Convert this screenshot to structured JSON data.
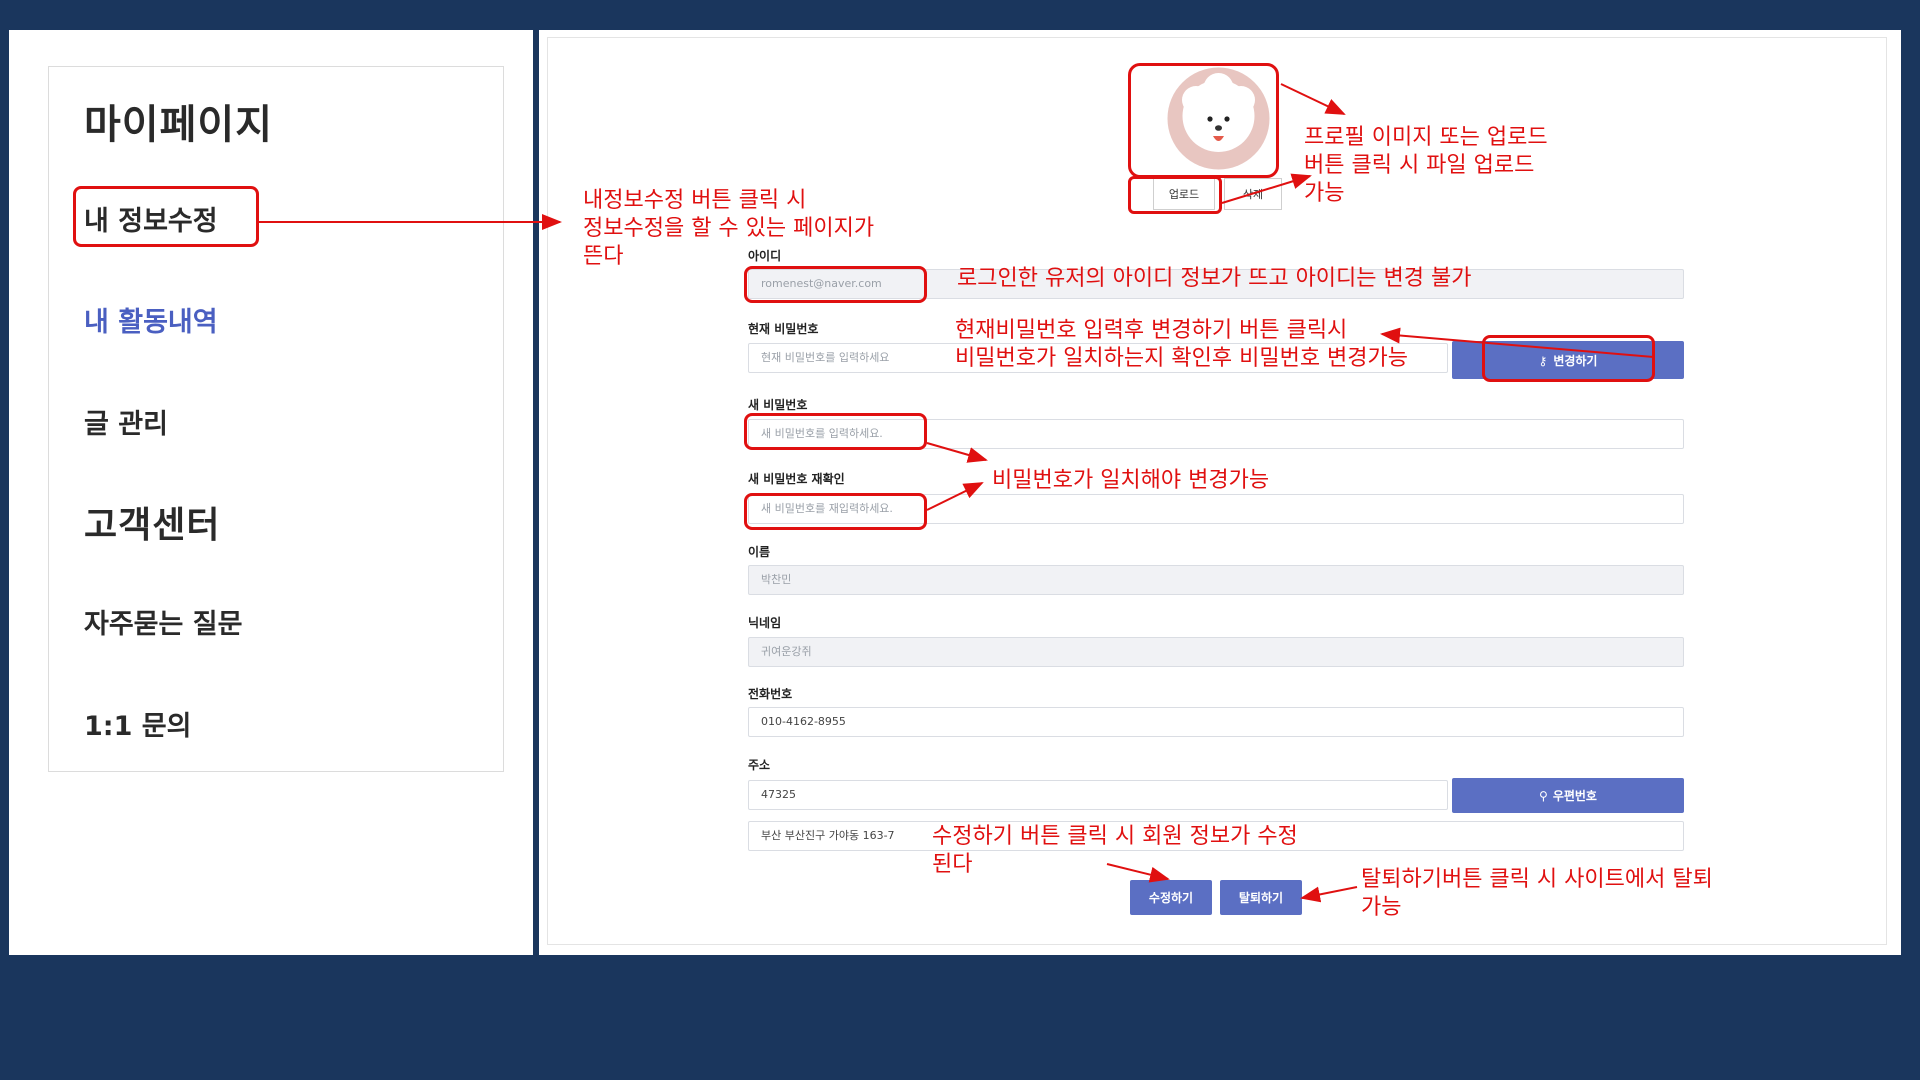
{
  "sidebar": {
    "title": "마이페이지",
    "items": [
      {
        "label": "내 정보수정"
      },
      {
        "label": "내 활동내역"
      },
      {
        "label": "글 관리"
      }
    ],
    "section_title": "고객센터",
    "support_items": [
      {
        "label": "자주묻는 질문"
      },
      {
        "label": "1:1 문의"
      }
    ]
  },
  "profile": {
    "upload_label": "업로드",
    "delete_label": "삭제"
  },
  "form": {
    "id_label": "아이디",
    "id_value": "romenest@naver.com",
    "current_pw_label": "현재 비밀번호",
    "current_pw_placeholder": "현재 비밀번호를 입력하세요",
    "change_label": "변경하기",
    "new_pw_label": "새 비밀번호",
    "new_pw_placeholder": "새 비밀번호를 입력하세요.",
    "confirm_pw_label": "새 비밀번호 재확인",
    "confirm_pw_placeholder": "새 비밀번호를 재입력하세요.",
    "name_label": "이름",
    "name_value": "박찬민",
    "nickname_label": "닉네임",
    "nickname_value": "귀여운강쥐",
    "phone_label": "전화번호",
    "phone_value": "010-4162-8955",
    "address_label": "주소",
    "zipcode_value": "47325",
    "zipcode_button": "우편번호",
    "address_value": "부산 부산진구 가야동 163-7",
    "submit_label": "수정하기",
    "withdraw_label": "탈퇴하기"
  },
  "annotations": {
    "edit_info": [
      "내정보수정 버튼 클릭 시",
      "정보수정을 할 수 있는 페이지가",
      "뜬다"
    ],
    "profile": [
      "프로필 이미지 또는 업로드",
      "버튼 클릭 시 파일 업로드",
      "가능"
    ],
    "id": [
      "로그인한 유저의 아이디 정보가 뜨고 아이디는 변경 불가"
    ],
    "password": [
      "현재비밀번호 입력후 변경하기 버튼 클릭시",
      "비밀번호가 일치하는지 확인후 비밀번호 변경가능"
    ],
    "match": [
      "비밀번호가 일치해야 변경가능"
    ],
    "submit": [
      "수정하기 버튼 클릭 시 회원 정보가 수정",
      "된다"
    ],
    "withdraw": [
      "탈퇴하기버튼 클릭 시 사이트에서 탈퇴",
      "가능"
    ]
  },
  "colors": {
    "background": "#1a365d",
    "accent": "#5b6fc3",
    "annotation": "#e01010",
    "active_menu": "#4a5fc1"
  },
  "icons": {
    "change_button": "key-icon",
    "zipcode_button": "search-icon",
    "profile": "dog-avatar-icon"
  }
}
